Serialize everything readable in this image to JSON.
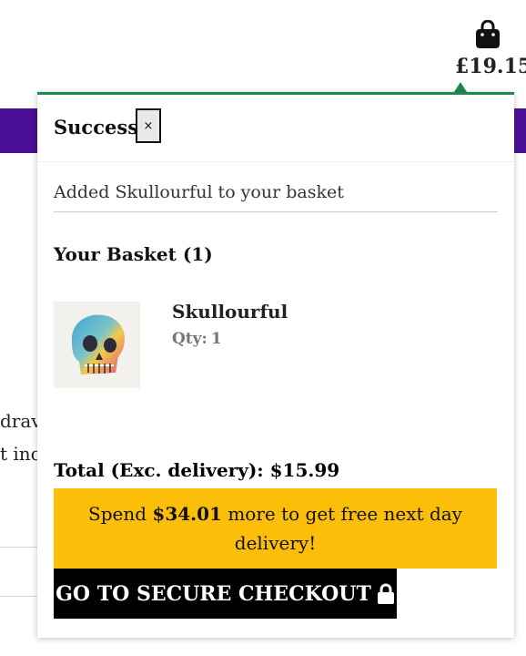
{
  "header": {
    "cart_total": "£19.15"
  },
  "background": {
    "line1": "drav",
    "line2": "t inc"
  },
  "popup": {
    "status_title": "Success!",
    "close_label": "×",
    "added_message": "Added Skullourful to your basket",
    "basket_heading": "Your Basket (1)",
    "item": {
      "name": "Skullourful",
      "qty_label": "Qty:",
      "qty_value": "1"
    },
    "total_text": "Total (Exc. delivery): $15.99",
    "promo": {
      "prefix": "Spend",
      "amount": "$34.01",
      "suffix": "more to get free next day delivery!"
    },
    "checkout_label": "GO TO SECURE CHECKOUT"
  },
  "colors": {
    "accent_green": "#1e8a4a",
    "promo_yellow": "#fbbf09",
    "band_purple": "#4b0f96",
    "button_black": "#000000"
  },
  "icons": [
    "shopping-bag-icon",
    "close-icon",
    "lock-icon"
  ]
}
